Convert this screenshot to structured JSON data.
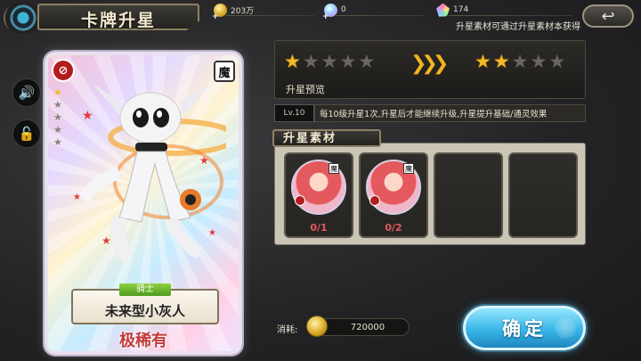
{
  "header": {
    "title": "卡牌升星",
    "hint": "升星素材可通过升星素材本获得",
    "back_icon": "↩"
  },
  "resources": [
    {
      "icon": "gold-coin-icon",
      "value": "203万"
    },
    {
      "icon": "orb-icon",
      "value": "0"
    },
    {
      "icon": "crystal-icon",
      "value": "174"
    }
  ],
  "sidebar": {
    "sound_icon": "🔊",
    "lock_icon": "🔓"
  },
  "card": {
    "no_icon": "⊘",
    "attribute": "魔",
    "class": "骑士",
    "name": "未来型小灰人",
    "rarity": "极稀有",
    "stars_filled": 1,
    "stars_total": 5
  },
  "preview": {
    "label": "升星预览",
    "current_stars": 1,
    "next_stars": 2,
    "max_stars": 5,
    "arrow": "❯❯❯"
  },
  "info": {
    "level": "Lv.10",
    "description": "每10级升星1次,升星后才能继续升级,升星提升基础/通灵效果"
  },
  "materials": {
    "title": "升星素材",
    "slots": [
      {
        "filled": true,
        "attr": "魔",
        "count": "0/1"
      },
      {
        "filled": true,
        "attr": "魔",
        "count": "0/2"
      },
      {
        "filled": false,
        "count": ""
      },
      {
        "filled": false,
        "count": ""
      }
    ]
  },
  "cost": {
    "label": "消耗:",
    "value": "720000"
  },
  "confirm_label": "确定"
}
